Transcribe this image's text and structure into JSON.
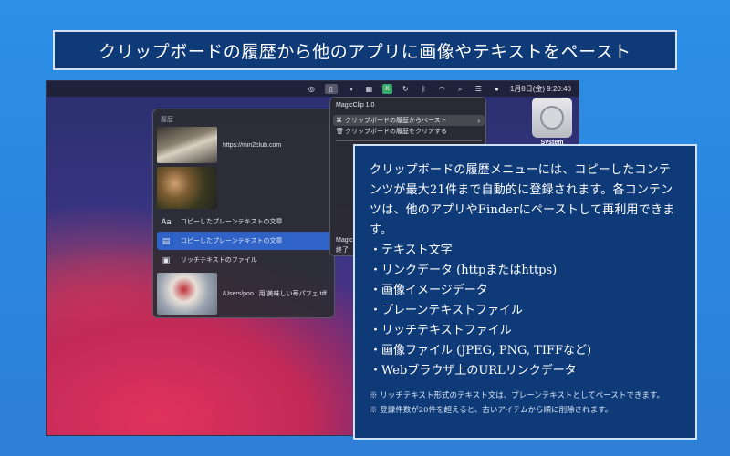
{
  "banner": {
    "title": "クリップボードの履歴から他のアプリに画像やテキストをペースト"
  },
  "menubar": {
    "icons": [
      "spiral-icon",
      "clipboard-icon",
      "yin-yang-icon",
      "grid-icon",
      "x-app-icon",
      "sync-icon",
      "bluetooth-icon",
      "wifi-icon",
      "search-icon",
      "control-center-icon",
      "user-icon"
    ],
    "datetime": "1月8日(金)  9:20:40"
  },
  "desktop": {
    "system_label": "System"
  },
  "history_panel": {
    "header": "履歴",
    "items": [
      {
        "type": "image",
        "text": "https://min2club.com"
      },
      {
        "type": "image",
        "text": ""
      },
      {
        "type": "text",
        "icon": "Aa",
        "text": "コピーしたプレーンテキストの文章"
      },
      {
        "type": "file",
        "icon": "▤",
        "text": "コピーしたプレーンテキストの文章"
      },
      {
        "type": "file",
        "icon": "▣",
        "text": "リッチテキストのファイル"
      },
      {
        "type": "image",
        "text": "/Users/poo...用/美味しい苺パフェ.tiff"
      }
    ]
  },
  "app_menu": {
    "title": "MagicClip 1.0",
    "items": [
      {
        "icon": "⌘",
        "label": "クリップボードの履歴からペースト",
        "arrow": "›"
      },
      {
        "icon": "🗑",
        "label": "クリップボードの履歴をクリアする",
        "arrow": ""
      }
    ],
    "bottom_items": [
      "Magic",
      "終了"
    ]
  },
  "description": {
    "intro": "クリップボードの履歴メニューには、コピーしたコンテンツが最大21件まで自動的に登録されます。各コンテンツは、他のアプリやFinderにペーストして再利用できます。",
    "list": [
      "・テキスト文字",
      "・リンクデータ (httpまたはhttps)",
      "・画像イメージデータ",
      "・プレーンテキストファイル",
      "・リッチテキストファイル",
      "・画像ファイル (JPEG, PNG, TIFFなど)",
      "・Webブラウザ上のURLリンクデータ"
    ],
    "notes": [
      "※ リッチテキスト形式のテキスト文は、プレーンテキストとしてペーストできます。",
      "※ 登録件数が20件を超えると、古いアイテムから順に削除されます。"
    ]
  }
}
